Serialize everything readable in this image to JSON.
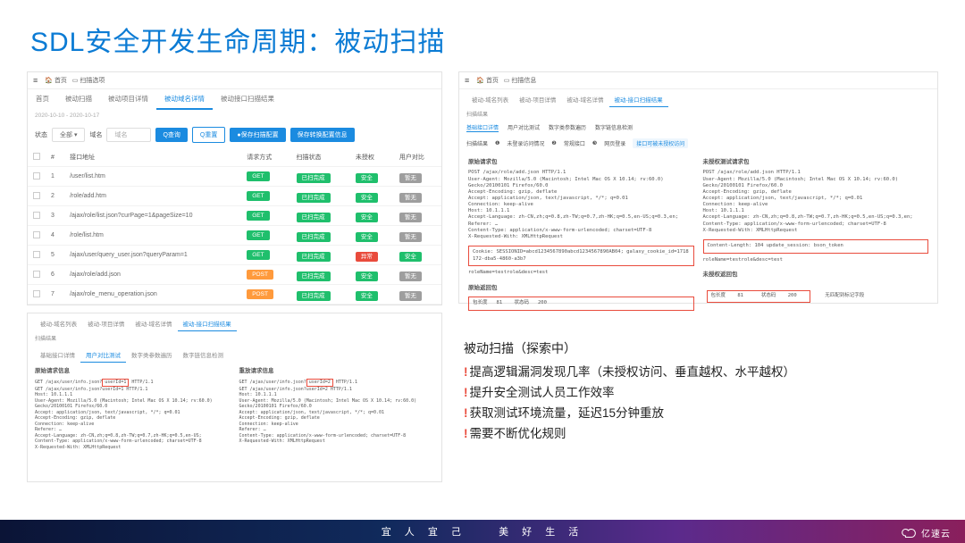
{
  "slide_title": "SDL安全开发生命周期：被动扫描",
  "breadcrumb1": "首页",
  "breadcrumb2": "扫描选项",
  "tabs_main": [
    "首页",
    "被动扫描",
    "被动项目详情",
    "被动域名详情",
    "被动接口扫描结果"
  ],
  "tabs_main_active": "被动域名详情",
  "date_range": "2020-10-10 - 2020-10-17",
  "filter_labels": {
    "status": "状态",
    "all": "全部",
    "domain": "域名",
    "placeholder": "域名"
  },
  "buttons": {
    "search": "Q查询",
    "reset": "Q重置",
    "save_cfg": "●保存扫描配置",
    "save_login_cfg": "保存转换配置信息"
  },
  "table": {
    "headers": [
      "",
      "#",
      "接口地址",
      "请求方式",
      "扫描状态",
      "未授权",
      "用户对比"
    ],
    "rows": [
      {
        "idx": "1",
        "url": "/user/list.htm",
        "method": "GET",
        "scan": "已扫完成",
        "auth": "安全",
        "cmp": "暂无"
      },
      {
        "idx": "2",
        "url": "/role/add.htm",
        "method": "GET",
        "scan": "已扫完成",
        "auth": "安全",
        "cmp": "暂无"
      },
      {
        "idx": "3",
        "url": "/ajax/role/list.json?curPage=1&pageSize=10",
        "method": "GET",
        "scan": "已扫完成",
        "auth": "安全",
        "cmp": "暂无"
      },
      {
        "idx": "4",
        "url": "/role/list.htm",
        "method": "GET",
        "scan": "已扫完成",
        "auth": "安全",
        "cmp": "暂无"
      },
      {
        "idx": "5",
        "url": "/ajax/user/query_user.json?queryParam=1",
        "method": "GET",
        "scan": "已扫完成",
        "auth": "异常",
        "cmp": "安全"
      },
      {
        "idx": "6",
        "url": "/ajax/role/add.json",
        "method": "POST",
        "scan": "已扫完成",
        "auth": "安全",
        "cmp": "暂无"
      },
      {
        "idx": "7",
        "url": "/ajax/role_menu_operation.json",
        "method": "POST",
        "scan": "已扫完成",
        "auth": "安全",
        "cmp": "暂无"
      }
    ]
  },
  "bottom_tabs1": [
    "被动-域名列表",
    "被动-项目详情",
    "被动-域名详情",
    "被动-接口扫描结果"
  ],
  "bottom_tabs1_active": "被动-接口扫描结果",
  "bottom_tabs2": [
    "基础接口详情",
    "用户对比测试",
    "数字类参数遍历",
    "数字链信息检测"
  ],
  "orig_req_title": "原始请求信息",
  "orig_req_text": "GET /ajax/user/info.json?userId=1 HTTP/1.1\nHost: 10.1.1.1\nUser-Agent: Mozilla/5.0 (Macintosh; Intel Mac OS X 10.14; rv:60.0) Gecko/20100101 Firefox/60.0\nAccept: application/json, text/javascript, */*; q=0.01\nAccept-Encoding: gzip, deflate\nConnection: keep-alive\nReferer: …\nAccept-Language: zh-CN,zh;q=0.8,zh-TW;q=0.7,zh-HK;q=0.5,en-US;\nContent-Type: application/x-www-form-urlencoded; charset=UTF-8\nX-Requested-With: XMLHttpRequest",
  "replay_req_title": "重放请求信息",
  "replay_req_text": "GET /ajax/user/info.json?userId=2 HTTP/1.1\nHost: 10.1.1.1\nUser-Agent: Mozilla/5.0 (Macintosh; Intel Mac OS X 10.14; rv:60.0) Gecko/20100101 Firefox/60.0\nAccept: application/json, text/javascript, */*; q=0.01\nAccept-Encoding: gzip, deflate\nConnection: keep-alive\nReferer: …\nContent-Type: application/x-www-form-urlencoded; charset=UTF-8\nX-Requested-With: XMLHttpRequest",
  "right_breadcrumb2": "扫描信息",
  "right_tabs": [
    "被动-域名列表",
    "被动-项目详情",
    "被动-域名详情",
    "被动-接口扫描结果"
  ],
  "right_tabs_active": "被动-接口扫描结果",
  "right_sub": "扫描结果",
  "right_sub_tabs": [
    "基础接口详情",
    "用户对比测试",
    "数字类参数遍历",
    "数字链信息检测"
  ],
  "scan_result": {
    "label": "扫描结果",
    "v1": "未登录访问情况",
    "v2": "常规接口",
    "v3": "网页登录",
    "tag": "接口可被未授权访问"
  },
  "orig_packet_title": "原始请求包",
  "orig_packet_text": "POST /ajax/role/add.json HTTP/1.1\nUser-Agent: Mozilla/5.0 (Macintosh; Intel Mac OS X 10.14; rv:60.0) Gecko/20100101 Firefox/60.0\nAccept-Encoding: gzip, deflate\nAccept: application/json, text/javascript, */*; q=0.01\nConnection: keep-alive\nHost: 10.1.1.1\nAccept-Language: zh-CN,zh;q=0.8,zh-TW;q=0.7,zh-HK;q=0.5,en-US;q=0.3,en;\nReferer: …\nContent-Type: application/x-www-form-urlencoded; charset=UTF-8\nX-Requested-With: XMLHttpRequest",
  "cookie_box": "Cookie: SESSIONID=abcd1234567890abcd1234567890AB04; galaxy_cookie_id=1718172-dba5-4860-a3b7",
  "noauth_packet_title": "未授权测试请求包",
  "noauth_packet_text": "POST /ajax/role/add.json HTTP/1.1\nUser-Agent: Mozilla/5.0 (Macintosh; Intel Mac OS X 10.14; rv:60.0) Gecko/20100101 Firefox/60.0\nAccept-Encoding: gzip, deflate\nAccept: application/json, text/javascript, */*; q=0.01\nConnection: keep-alive\nHost: 10.1.1.1\nAccept-Language: zh-CN,zh;q=0.8,zh-TW;q=0.7,zh-HK;q=0.5,en-US;q=0.3,en;\nContent-Type: application/x-www-form-urlencoded; charset=UTF-8\nX-Requested-With: XMLHttpRequest",
  "noauth_cookie_box": "Content-Length: 104\nupdate_session: bson_token",
  "resp_note": "roleName=testrole&desc=test",
  "orig_resp_title": "原始返回包",
  "orig_resp_s": "包长度",
  "orig_resp_v": "81",
  "orig_resp_s2": "状态码",
  "orig_resp_v2": "200",
  "noauth_resp_title": "未授权返回包",
  "noauth_resp_s": "包长度",
  "noauth_resp_v": "81",
  "noauth_resp_s2": "状态码",
  "noauth_resp_v2": "200",
  "noauth_resp_tail": "无匹配到标记字段",
  "desc_title": "被动扫描（探索中）",
  "desc_items": [
    "提高逻辑漏洞发现几率（未授权访问、垂直越权、水平越权）",
    "提升安全测试人员工作效率",
    "获取测试环境流量，延迟15分钟重放",
    "需要不断优化规则"
  ],
  "footer_l": "宜 人 宜 己",
  "footer_r": "美 好 生 活",
  "brand": "亿速云"
}
